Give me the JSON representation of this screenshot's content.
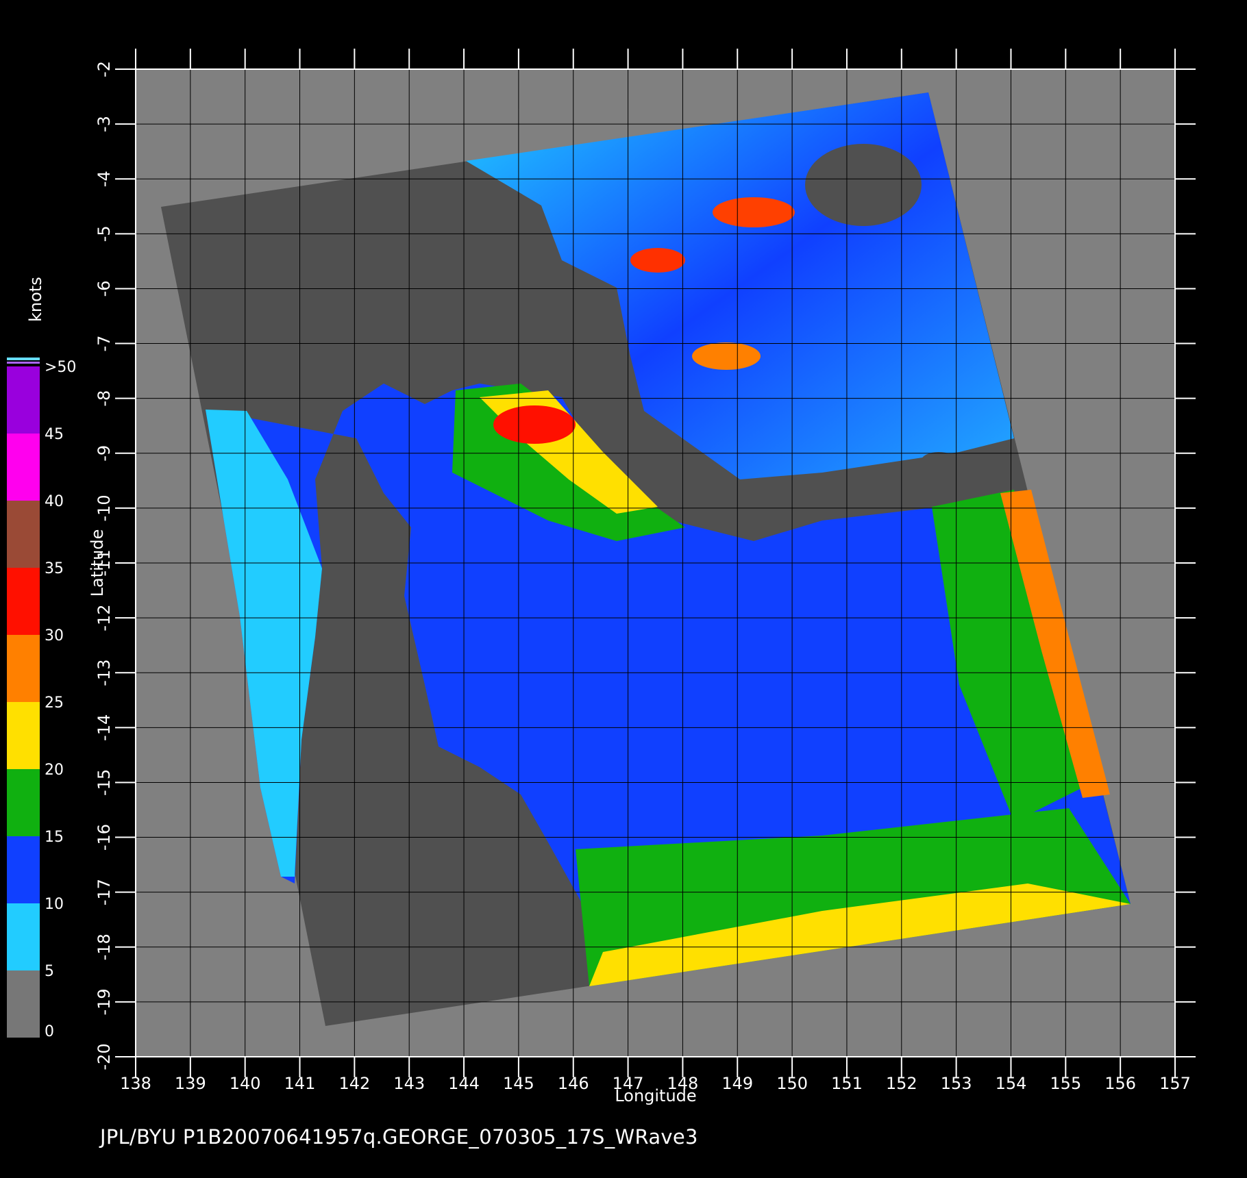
{
  "figure": {
    "caption": "JPL/BYU  P1B20070641957q.GEORGE_070305_17S_WRave3",
    "x_axis_label": "Longitude",
    "y_axis_label": "Latitude",
    "x_range": [
      138,
      157
    ],
    "y_range": [
      -20,
      -2
    ],
    "lon_ticks": [
      "138",
      "139",
      "140",
      "141",
      "142",
      "143",
      "144",
      "145",
      "146",
      "147",
      "148",
      "149",
      "150",
      "151",
      "152",
      "153",
      "154",
      "155",
      "156",
      "157"
    ],
    "lat_ticks": [
      "-2",
      "-3",
      "-4",
      "-5",
      "-6",
      "-7",
      "-8",
      "-9",
      "-10",
      "-11",
      "-12",
      "-13",
      "-14",
      "-15",
      "-16",
      "-17",
      "-18",
      "-19",
      "-20"
    ]
  },
  "colorbar": {
    "unit_label": "knots",
    "tick_labels": [
      "0",
      "5",
      "10",
      "15",
      "20",
      "25",
      "30",
      "35",
      "40",
      "45",
      ">50"
    ],
    "bands": [
      {
        "from": 0,
        "to": 5,
        "color": "#777777"
      },
      {
        "from": 5,
        "to": 10,
        "color": "#22ccff"
      },
      {
        "from": 10,
        "to": 15,
        "color": "#1040ff"
      },
      {
        "from": 15,
        "to": 20,
        "color": "#10b010"
      },
      {
        "from": 20,
        "to": 25,
        "color": "#ffe000"
      },
      {
        "from": 25,
        "to": 30,
        "color": "#ff8000"
      },
      {
        "from": 30,
        "to": 35,
        "color": "#ff1000"
      },
      {
        "from": 35,
        "to": 40,
        "color": "#9a4a36"
      },
      {
        "from": 40,
        "to": 45,
        "color": "#ff00ee"
      },
      {
        "from": 45,
        "to": 50,
        "color": "#9900dd"
      }
    ]
  },
  "colors": {
    "background": "#000000",
    "plot_fill": "#808080",
    "no_data_swath": "#505050",
    "grid": "#000000",
    "text": "#ffffff"
  }
}
